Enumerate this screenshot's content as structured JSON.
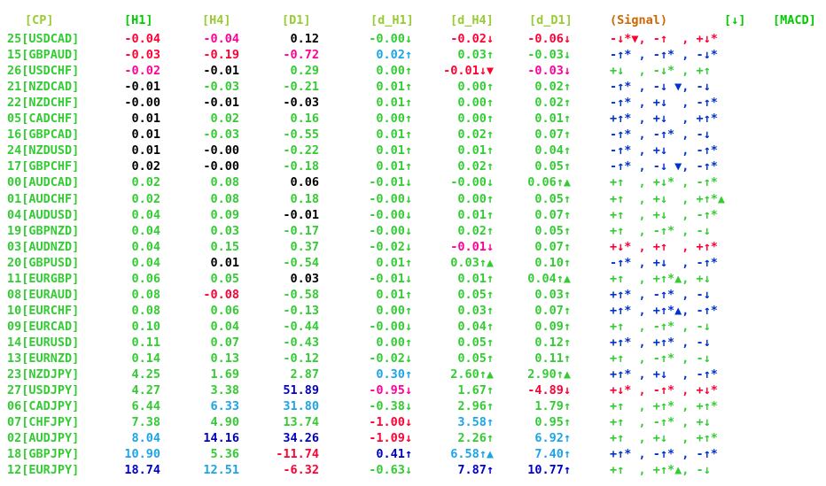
{
  "colors": {
    "header": "#99cc33",
    "signal_header": "#cc6600",
    "green": "#33cc33",
    "black": "#000000",
    "red": "#ff0033",
    "magenta": "#ff0099",
    "cyan": "#1ca5e6",
    "navy": "#0000cc",
    "blue": "#0033cc",
    "green_header": "#00cc00"
  },
  "header": {
    "cp": "[CP]",
    "h1": "[H1]",
    "h4": "[H4]",
    "d1": "[D1]",
    "dh1": "[d_H1]",
    "dh4": "[d_H4]",
    "dd1": "[d_D1]",
    "signal": "(Signal)",
    "arrow": "[↓]",
    "macd": "[MACD]"
  },
  "rows": [
    {
      "cp": "25[USDCAD]",
      "h1": "-0.04",
      "h1c": "red",
      "h4": "-0.04",
      "h4c": "magenta",
      "d1": "0.12",
      "d1c": "black",
      "dh1": "-0.00↓",
      "dh1c": "green",
      "dh4": "-0.02↓",
      "dh4c": "red",
      "dd1": "-0.06↓",
      "dd1c": "red",
      "sig": "-↓*▼, -↑  , +↓*",
      "sigc": "red"
    },
    {
      "cp": "15[GBPAUD]",
      "h1": "-0.03",
      "h1c": "red",
      "h4": "-0.19",
      "h4c": "red",
      "d1": "-0.72",
      "d1c": "magenta",
      "dh1": "0.02↑",
      "dh1c": "cyan",
      "dh4": "0.03↑",
      "dh4c": "green",
      "dd1": "-0.03↓",
      "dd1c": "green",
      "sig": "-↑* , -↑* , -↓*",
      "sigc": "blue"
    },
    {
      "cp": "26[USDCHF]",
      "h1": "-0.02",
      "h1c": "magenta",
      "h4": "-0.01",
      "h4c": "black",
      "d1": "0.29",
      "d1c": "green",
      "dh1": "0.00↑",
      "dh1c": "green",
      "dh4": "-0.01↓▼",
      "dh4c": "red",
      "dd1": "-0.03↓",
      "dd1c": "magenta",
      "sig": "+↓  , -↓* , +↑",
      "sigc": "green"
    },
    {
      "cp": "21[NZDCAD]",
      "h1": "-0.01",
      "h1c": "black",
      "h4": "-0.03",
      "h4c": "green",
      "d1": "-0.21",
      "d1c": "green",
      "dh1": "0.01↑",
      "dh1c": "green",
      "dh4": "0.00↑",
      "dh4c": "green",
      "dd1": "0.02↑",
      "dd1c": "green",
      "sig": "-↑* , -↓ ▼, -↓",
      "sigc": "blue"
    },
    {
      "cp": "22[NZDCHF]",
      "h1": "-0.00",
      "h1c": "black",
      "h4": "-0.01",
      "h4c": "black",
      "d1": "-0.03",
      "d1c": "black",
      "dh1": "0.01↑",
      "dh1c": "green",
      "dh4": "0.00↑",
      "dh4c": "green",
      "dd1": "0.02↑",
      "dd1c": "green",
      "sig": "-↑* , +↓  , -↑*",
      "sigc": "blue"
    },
    {
      "cp": "05[CADCHF]",
      "h1": "0.01",
      "h1c": "black",
      "h4": "0.02",
      "h4c": "green",
      "d1": "0.16",
      "d1c": "green",
      "dh1": "0.00↑",
      "dh1c": "green",
      "dh4": "0.00↑",
      "dh4c": "green",
      "dd1": "0.01↑",
      "dd1c": "green",
      "sig": "+↑* , +↓  , +↑*",
      "sigc": "blue"
    },
    {
      "cp": "16[GBPCAD]",
      "h1": "0.01",
      "h1c": "black",
      "h4": "-0.03",
      "h4c": "green",
      "d1": "-0.55",
      "d1c": "green",
      "dh1": "0.01↑",
      "dh1c": "green",
      "dh4": "0.02↑",
      "dh4c": "green",
      "dd1": "0.07↑",
      "dd1c": "green",
      "sig": "-↑* , -↑* , -↓",
      "sigc": "blue"
    },
    {
      "cp": "24[NZDUSD]",
      "h1": "0.01",
      "h1c": "black",
      "h4": "-0.00",
      "h4c": "black",
      "d1": "-0.22",
      "d1c": "green",
      "dh1": "0.01↑",
      "dh1c": "green",
      "dh4": "0.01↑",
      "dh4c": "green",
      "dd1": "0.04↑",
      "dd1c": "green",
      "sig": "-↑* , +↓  , -↑*",
      "sigc": "blue"
    },
    {
      "cp": "17[GBPCHF]",
      "h1": "0.02",
      "h1c": "black",
      "h4": "-0.00",
      "h4c": "black",
      "d1": "-0.18",
      "d1c": "green",
      "dh1": "0.01↑",
      "dh1c": "green",
      "dh4": "0.02↑",
      "dh4c": "green",
      "dd1": "0.05↑",
      "dd1c": "green",
      "sig": "-↑* , -↓ ▼, -↑*",
      "sigc": "blue"
    },
    {
      "cp": "00[AUDCAD]",
      "h1": "0.02",
      "h1c": "green",
      "h4": "0.08",
      "h4c": "green",
      "d1": "0.06",
      "d1c": "black",
      "dh1": "-0.01↓",
      "dh1c": "green",
      "dh4": "-0.00↓",
      "dh4c": "green",
      "dd1": "0.06↑▲",
      "dd1c": "green",
      "sig": "+↑  , +↓* , -↑*",
      "sigc": "green"
    },
    {
      "cp": "01[AUDCHF]",
      "h1": "0.02",
      "h1c": "green",
      "h4": "0.08",
      "h4c": "green",
      "d1": "0.18",
      "d1c": "green",
      "dh1": "-0.00↓",
      "dh1c": "green",
      "dh4": "0.00↑",
      "dh4c": "green",
      "dd1": "0.05↑",
      "dd1c": "green",
      "sig": "+↑  , +↓  , +↑*▲",
      "sigc": "green"
    },
    {
      "cp": "04[AUDUSD]",
      "h1": "0.04",
      "h1c": "green",
      "h4": "0.09",
      "h4c": "green",
      "d1": "-0.01",
      "d1c": "black",
      "dh1": "-0.00↓",
      "dh1c": "green",
      "dh4": "0.01↑",
      "dh4c": "green",
      "dd1": "0.07↑",
      "dd1c": "green",
      "sig": "+↑  , +↓  , -↑*",
      "sigc": "green"
    },
    {
      "cp": "19[GBPNZD]",
      "h1": "0.04",
      "h1c": "green",
      "h4": "0.03",
      "h4c": "green",
      "d1": "-0.17",
      "d1c": "green",
      "dh1": "-0.00↓",
      "dh1c": "green",
      "dh4": "0.02↑",
      "dh4c": "green",
      "dd1": "0.05↑",
      "dd1c": "green",
      "sig": "+↑  , -↑* , -↓",
      "sigc": "green"
    },
    {
      "cp": "03[AUDNZD]",
      "h1": "0.04",
      "h1c": "green",
      "h4": "0.15",
      "h4c": "green",
      "d1": "0.37",
      "d1c": "green",
      "dh1": "-0.02↓",
      "dh1c": "green",
      "dh4": "-0.01↓",
      "dh4c": "magenta",
      "dd1": "0.07↑",
      "dd1c": "green",
      "sig": "+↓* , +↑  , +↑*",
      "sigc": "red"
    },
    {
      "cp": "20[GBPUSD]",
      "h1": "0.04",
      "h1c": "green",
      "h4": "0.01",
      "h4c": "black",
      "d1": "-0.54",
      "d1c": "green",
      "dh1": "0.01↑",
      "dh1c": "green",
      "dh4": "0.03↑▲",
      "dh4c": "green",
      "dd1": "0.10↑",
      "dd1c": "green",
      "sig": "-↑* , +↓  , -↑*",
      "sigc": "blue"
    },
    {
      "cp": "11[EURGBP]",
      "h1": "0.06",
      "h1c": "green",
      "h4": "0.05",
      "h4c": "green",
      "d1": "0.03",
      "d1c": "black",
      "dh1": "-0.01↓",
      "dh1c": "green",
      "dh4": "0.01↑",
      "dh4c": "green",
      "dd1": "0.04↑▲",
      "dd1c": "green",
      "sig": "+↑  , +↑*▲, +↓",
      "sigc": "green"
    },
    {
      "cp": "08[EURAUD]",
      "h1": "0.08",
      "h1c": "green",
      "h4": "-0.08",
      "h4c": "red",
      "d1": "-0.58",
      "d1c": "green",
      "dh1": "0.01↑",
      "dh1c": "green",
      "dh4": "0.05↑",
      "dh4c": "green",
      "dd1": "0.03↑",
      "dd1c": "green",
      "sig": "+↑* , -↑* , -↓",
      "sigc": "blue"
    },
    {
      "cp": "10[EURCHF]",
      "h1": "0.08",
      "h1c": "green",
      "h4": "0.06",
      "h4c": "green",
      "d1": "-0.13",
      "d1c": "green",
      "dh1": "0.00↑",
      "dh1c": "green",
      "dh4": "0.03↑",
      "dh4c": "green",
      "dd1": "0.07↑",
      "dd1c": "green",
      "sig": "+↑* , +↑*▲, -↑*",
      "sigc": "blue"
    },
    {
      "cp": "09[EURCAD]",
      "h1": "0.10",
      "h1c": "green",
      "h4": "0.04",
      "h4c": "green",
      "d1": "-0.44",
      "d1c": "green",
      "dh1": "-0.00↓",
      "dh1c": "green",
      "dh4": "0.04↑",
      "dh4c": "green",
      "dd1": "0.09↑",
      "dd1c": "green",
      "sig": "+↑  , -↑* , -↓",
      "sigc": "green"
    },
    {
      "cp": "14[EURUSD]",
      "h1": "0.11",
      "h1c": "green",
      "h4": "0.07",
      "h4c": "green",
      "d1": "-0.43",
      "d1c": "green",
      "dh1": "0.00↑",
      "dh1c": "green",
      "dh4": "0.05↑",
      "dh4c": "green",
      "dd1": "0.12↑",
      "dd1c": "green",
      "sig": "+↑* , +↑* , -↓",
      "sigc": "blue"
    },
    {
      "cp": "13[EURNZD]",
      "h1": "0.14",
      "h1c": "green",
      "h4": "0.13",
      "h4c": "green",
      "d1": "-0.12",
      "d1c": "green",
      "dh1": "-0.02↓",
      "dh1c": "green",
      "dh4": "0.05↑",
      "dh4c": "green",
      "dd1": "0.11↑",
      "dd1c": "green",
      "sig": "+↑  , -↑* , -↓",
      "sigc": "green"
    },
    {
      "cp": "23[NZDJPY]",
      "h1": "4.25",
      "h1c": "green",
      "h4": "1.69",
      "h4c": "green",
      "d1": "2.87",
      "d1c": "green",
      "dh1": "0.30↑",
      "dh1c": "cyan",
      "dh4": "2.60↑▲",
      "dh4c": "green",
      "dd1": "2.90↑▲",
      "dd1c": "green",
      "sig": "+↑* , +↓  , -↑*",
      "sigc": "blue"
    },
    {
      "cp": "27[USDJPY]",
      "h1": "4.27",
      "h1c": "green",
      "h4": "3.38",
      "h4c": "green",
      "d1": "51.89",
      "d1c": "navy",
      "dh1": "-0.95↓",
      "dh1c": "magenta",
      "dh4": "1.67↑",
      "dh4c": "green",
      "dd1": "-4.89↓",
      "dd1c": "red",
      "sig": "+↓* , -↑* , +↓*",
      "sigc": "red"
    },
    {
      "cp": "06[CADJPY]",
      "h1": "6.44",
      "h1c": "green",
      "h4": "6.33",
      "h4c": "cyan",
      "d1": "31.80",
      "d1c": "cyan",
      "dh1": "-0.38↓",
      "dh1c": "green",
      "dh4": "2.96↑",
      "dh4c": "green",
      "dd1": "1.79↑",
      "dd1c": "green",
      "sig": "+↑  , +↑* , +↑*",
      "sigc": "green"
    },
    {
      "cp": "07[CHFJPY]",
      "h1": "7.38",
      "h1c": "green",
      "h4": "4.90",
      "h4c": "green",
      "d1": "13.74",
      "d1c": "green",
      "dh1": "-1.00↓",
      "dh1c": "red",
      "dh4": "3.58↑",
      "dh4c": "cyan",
      "dd1": "0.95↑",
      "dd1c": "green",
      "sig": "+↑  , -↑* , +↓",
      "sigc": "green"
    },
    {
      "cp": "02[AUDJPY]",
      "h1": "8.04",
      "h1c": "cyan",
      "h4": "14.16",
      "h4c": "navy",
      "d1": "34.26",
      "d1c": "navy",
      "dh1": "-1.09↓",
      "dh1c": "red",
      "dh4": "2.26↑",
      "dh4c": "green",
      "dd1": "6.92↑",
      "dd1c": "cyan",
      "sig": "+↑  , +↓  , +↑*",
      "sigc": "green"
    },
    {
      "cp": "18[GBPJPY]",
      "h1": "10.90",
      "h1c": "cyan",
      "h4": "5.36",
      "h4c": "green",
      "d1": "-11.74",
      "d1c": "red",
      "dh1": "0.41↑",
      "dh1c": "navy",
      "dh4": "6.58↑▲",
      "dh4c": "cyan",
      "dd1": "7.40↑",
      "dd1c": "cyan",
      "sig": "+↑* , -↑* , -↑*",
      "sigc": "blue"
    },
    {
      "cp": "12[EURJPY]",
      "h1": "18.74",
      "h1c": "navy",
      "h4": "12.51",
      "h4c": "cyan",
      "d1": "-6.32",
      "d1c": "red",
      "dh1": "-0.63↓",
      "dh1c": "green",
      "dh4": "7.87↑",
      "dh4c": "navy",
      "dd1": "10.77↑",
      "dd1c": "navy",
      "sig": "+↑  , +↑*▲, -↓",
      "sigc": "green"
    }
  ]
}
